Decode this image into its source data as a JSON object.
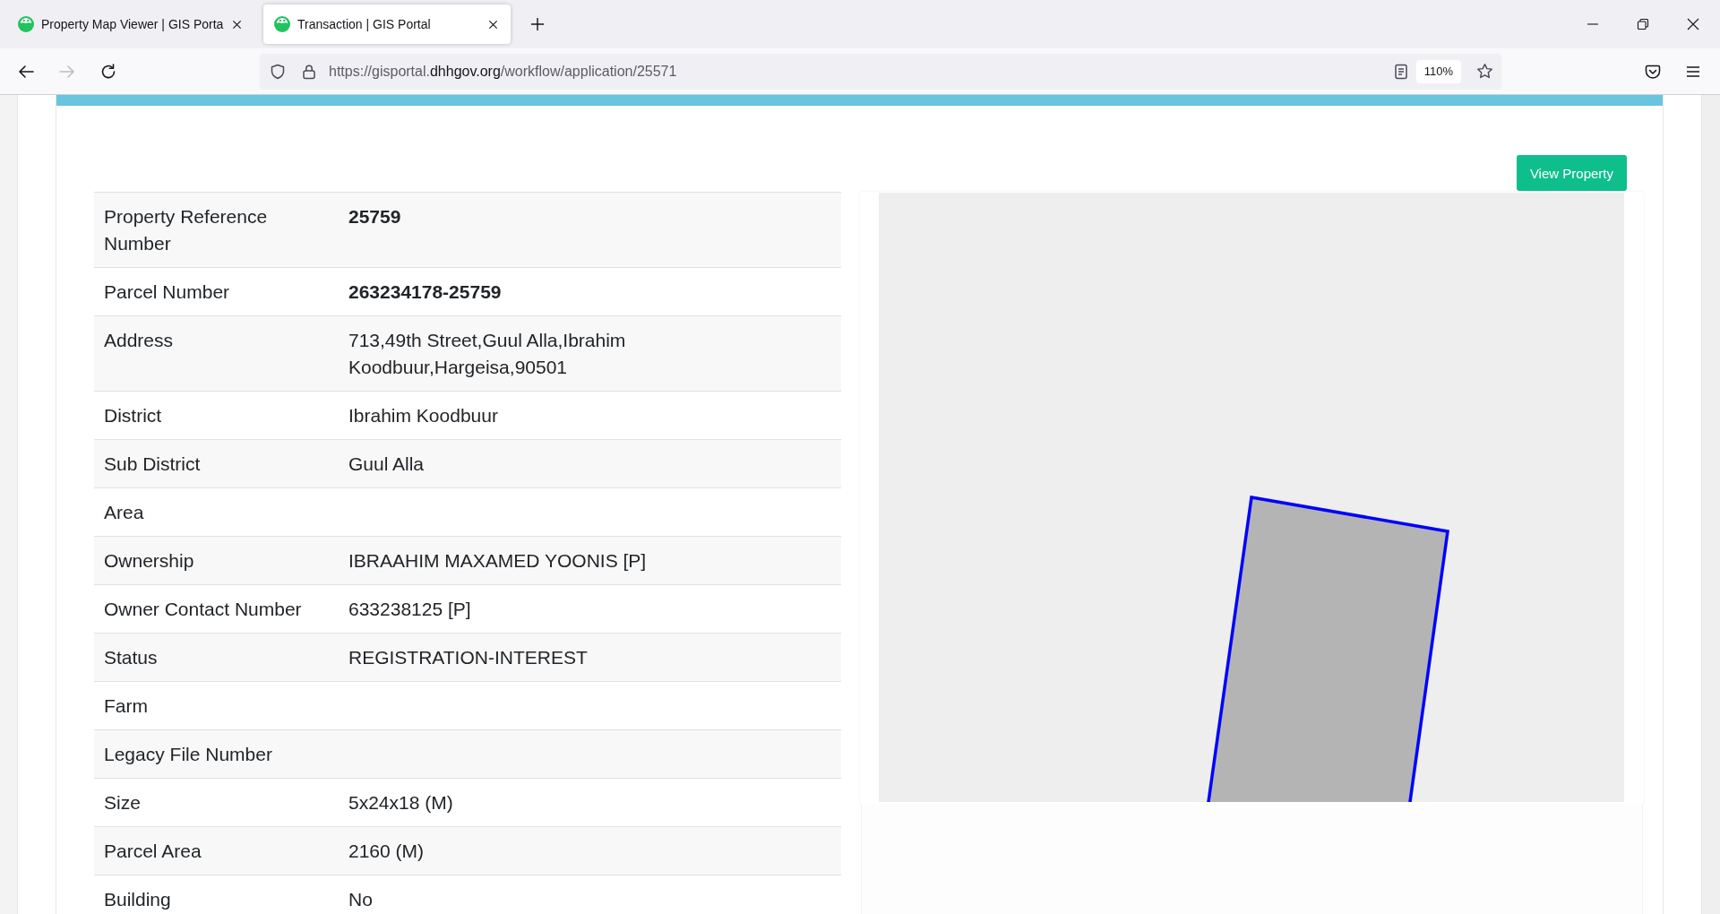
{
  "browser": {
    "tabs": [
      {
        "title": "Property Map Viewer | GIS Porta",
        "selected": false
      },
      {
        "title": "Transaction | GIS Portal",
        "selected": true
      }
    ],
    "nav_buttons": [
      {
        "kind": "back",
        "disabled": false
      },
      {
        "kind": "forward",
        "disabled": true
      },
      {
        "kind": "reload",
        "disabled": false
      }
    ],
    "address_bar": {
      "url": {
        "before_domain": "https://gisportal.",
        "domain": "dhhgov.org",
        "after_domain": "/workflow/application/25571"
      },
      "zoom": "110%"
    }
  },
  "page": {
    "view_property_button": "View Property",
    "property_details": [
      {
        "label": "Property Reference Number",
        "value": "25759",
        "emphasis": true
      },
      {
        "label": "Parcel Number",
        "value": "263234178-25759",
        "emphasis": true
      },
      {
        "label": "Address",
        "value": "713,49th Street,Guul Alla,Ibrahim Koodbuur,Hargeisa,90501",
        "emphasis": false
      },
      {
        "label": "District",
        "value": "Ibrahim Koodbuur",
        "emphasis": false
      },
      {
        "label": "Sub District",
        "value": "Guul Alla",
        "emphasis": false
      },
      {
        "label": "Area"
      },
      {
        "label": "Ownership",
        "value": "IBRAAHIM MAXAMED YOONIS [P]",
        "emphasis": false
      },
      {
        "label": "Owner Contact Number",
        "value": "633238125 [P]",
        "emphasis": false
      },
      {
        "label": "Status",
        "value": "REGISTRATION-INTEREST",
        "emphasis": false
      },
      {
        "label": "Farm"
      },
      {
        "label": "Legacy File Number"
      },
      {
        "label": "Size",
        "value": "5x24x18 (M)",
        "emphasis": false
      },
      {
        "label": "Parcel Area",
        "value": "2160 (M)",
        "emphasis": false
      },
      {
        "label": "Building",
        "value": "No",
        "emphasis": false
      }
    ]
  }
}
